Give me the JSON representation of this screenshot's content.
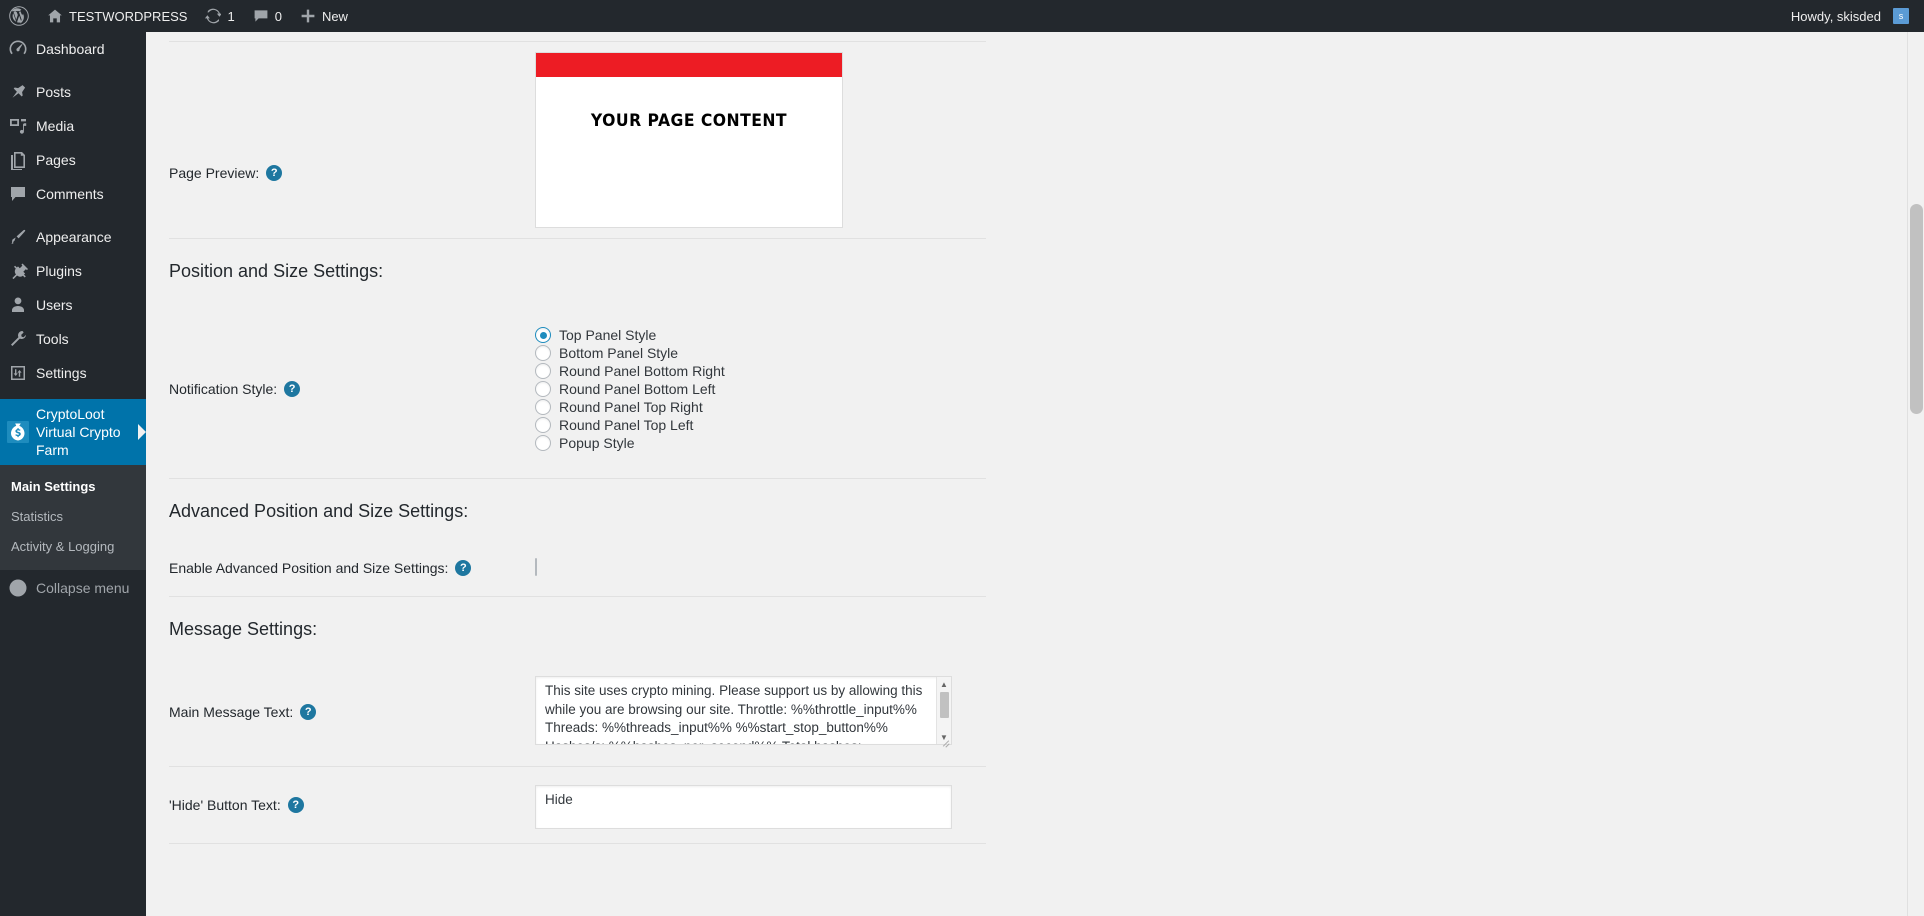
{
  "adminbar": {
    "logo_icon": "wordpress-logo-icon",
    "home_icon": "home-icon",
    "site_name": "TESTWORDPRESS",
    "updates_icon": "updates-icon",
    "updates_count": "1",
    "comments_icon": "comment-bubble-icon",
    "comments_count": "0",
    "new_icon": "plus-icon",
    "new_label": "New",
    "howdy": "Howdy, skisded",
    "avatar_initial": "s"
  },
  "sidebar": {
    "items": [
      {
        "label": "Dashboard",
        "icon": "dashboard-icon",
        "name": "sidebar-item-dashboard"
      },
      {
        "label": "Posts",
        "icon": "pin-icon",
        "name": "sidebar-item-posts"
      },
      {
        "label": "Media",
        "icon": "media-icon",
        "name": "sidebar-item-media"
      },
      {
        "label": "Pages",
        "icon": "pages-icon",
        "name": "sidebar-item-pages"
      },
      {
        "label": "Comments",
        "icon": "comment-bubble-icon",
        "name": "sidebar-item-comments"
      },
      {
        "label": "Appearance",
        "icon": "paintbrush-icon",
        "name": "sidebar-item-appearance"
      },
      {
        "label": "Plugins",
        "icon": "plug-icon",
        "name": "sidebar-item-plugins"
      },
      {
        "label": "Users",
        "icon": "user-icon",
        "name": "sidebar-item-users"
      },
      {
        "label": "Tools",
        "icon": "wrench-icon",
        "name": "sidebar-item-tools"
      },
      {
        "label": "Settings",
        "icon": "sliders-icon",
        "name": "sidebar-item-settings"
      }
    ],
    "current_item": {
      "label": "CryptoLoot Virtual Crypto Farm",
      "icon": "money-bag-icon",
      "name": "sidebar-item-cryptoloot"
    },
    "submenu": [
      {
        "label": "Main Settings",
        "current": true
      },
      {
        "label": "Statistics",
        "current": false
      },
      {
        "label": "Activity & Logging",
        "current": false
      }
    ],
    "collapse": {
      "label": "Collapse menu",
      "icon": "collapse-arrow-icon"
    }
  },
  "main": {
    "page_preview": {
      "label": "Page Preview:",
      "help_glyph": "?",
      "bar_color": "#ed1c24",
      "content_text": "YOUR PAGE CONTENT"
    },
    "position_size": {
      "heading": "Position and Size Settings:",
      "notification_style_label": "Notification Style:",
      "help_glyph": "?",
      "options": [
        {
          "label": "Top Panel Style",
          "selected": true
        },
        {
          "label": "Bottom Panel Style",
          "selected": false
        },
        {
          "label": "Round Panel Bottom Right",
          "selected": false
        },
        {
          "label": "Round Panel Bottom Left",
          "selected": false
        },
        {
          "label": "Round Panel Top Right",
          "selected": false
        },
        {
          "label": "Round Panel Top Left",
          "selected": false
        },
        {
          "label": "Popup Style",
          "selected": false
        }
      ]
    },
    "advanced": {
      "heading": "Advanced Position and Size Settings:",
      "enable_label": "Enable Advanced Position and Size Settings:",
      "help_glyph": "?",
      "checked": false
    },
    "message": {
      "heading": "Message Settings:",
      "main_message_label": "Main Message Text:",
      "help_glyph": "?",
      "main_message_value": "This site uses crypto mining. Please support us by allowing this while you are browsing our site. Throttle: %%throttle_input%% Threads: %%threads_input%% %%start_stop_button%% Hashes/s: %%hashes_per_second%% Total hashes: %%hashes_total%%",
      "hide_button_label": "'Hide' Button Text:",
      "hide_button_value": "Hide"
    }
  },
  "colors": {
    "admin_bar": "#23282d",
    "sidebar": "#23282d",
    "sidebar_active": "#0073aa",
    "submenu_bg": "#32373c",
    "accent_link": "#0073aa",
    "help_icon": "#1e77a0",
    "content_bg": "#f1f1f1",
    "preview_bar": "#ed1c24"
  }
}
